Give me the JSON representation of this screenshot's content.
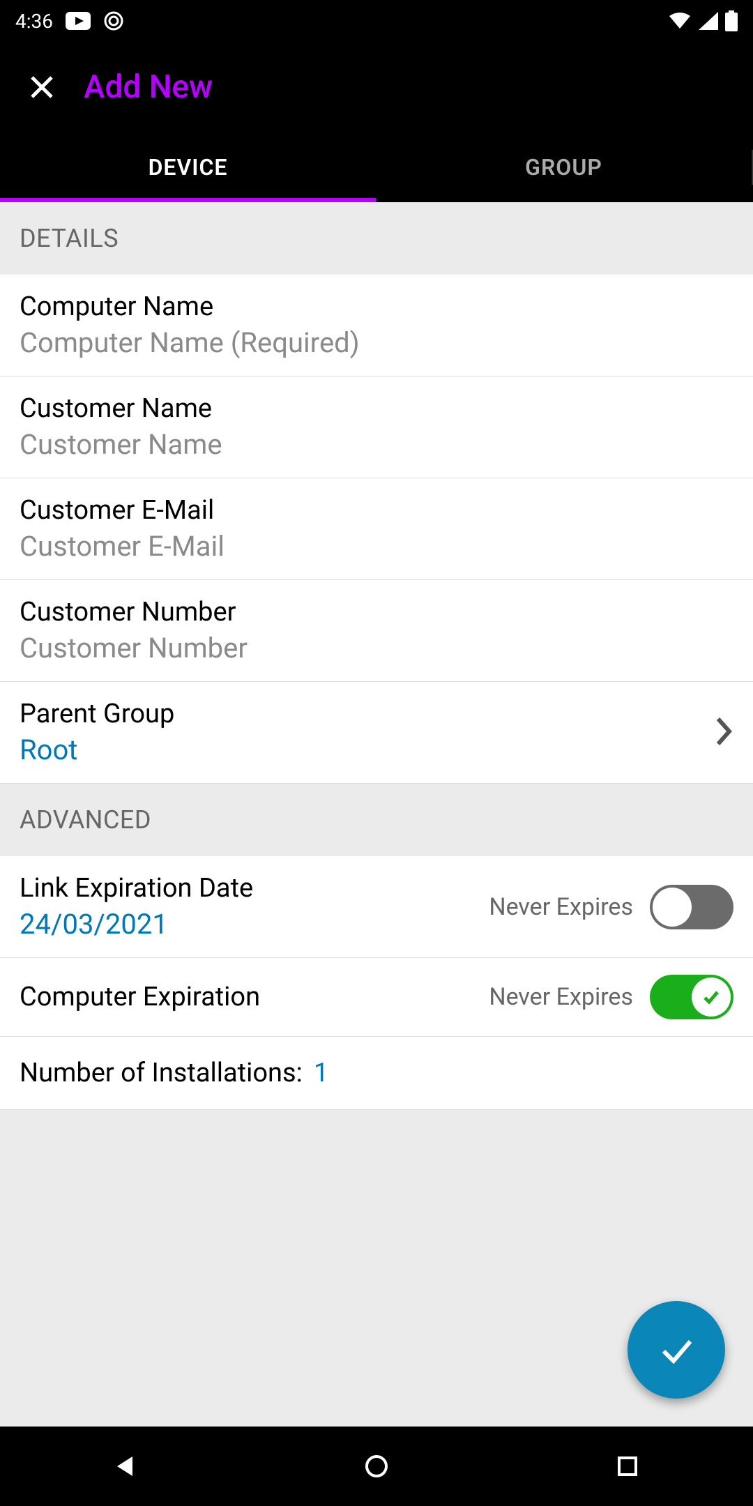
{
  "status": {
    "time": "4:36"
  },
  "header": {
    "title": "Add New"
  },
  "tabs": {
    "device": "DEVICE",
    "group": "GROUP"
  },
  "sections": {
    "details": "DETAILS",
    "advanced": "ADVANCED"
  },
  "fields": {
    "computer_name": {
      "label": "Computer Name",
      "placeholder": "Computer Name (Required)",
      "value": ""
    },
    "customer_name": {
      "label": "Customer Name",
      "placeholder": "Customer Name",
      "value": ""
    },
    "customer_email": {
      "label": "Customer E-Mail",
      "placeholder": "Customer E-Mail",
      "value": ""
    },
    "customer_number": {
      "label": "Customer Number",
      "placeholder": "Customer Number",
      "value": ""
    },
    "parent_group": {
      "label": "Parent Group",
      "value": "Root"
    },
    "link_expiration": {
      "label": "Link Expiration Date",
      "value": "24/03/2021",
      "never_expires_label": "Never Expires",
      "never_expires_on": false
    },
    "computer_expiration": {
      "label": "Computer Expiration",
      "never_expires_label": "Never Expires",
      "never_expires_on": true
    },
    "installations": {
      "label": "Number of Installations:",
      "value": "1"
    }
  }
}
